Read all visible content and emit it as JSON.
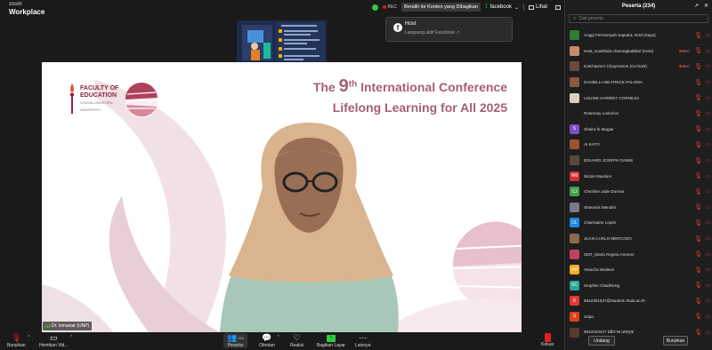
{
  "app": {
    "brand_top": "zoom",
    "brand_name": "Workplace"
  },
  "topbar": {
    "rec_label": "REC",
    "live_label": "Beralih ke Konten yang Dibagikan",
    "facebook_label": "facebook",
    "view_label": "Lihat"
  },
  "host_popup": {
    "title": "Host",
    "subtitle": "Langsung aktif Facebook"
  },
  "slide": {
    "line1_pre": "The ",
    "line1_num": "9",
    "line1_sup": "th",
    "line1_post": " International Conference",
    "line2": "Lifelong Learning for All 2025",
    "faculty_line1": "FACULTY OF",
    "faculty_line2": "EDUCATION",
    "faculty_line3": "CHULALONGKORN",
    "faculty_line4": "UNIVERSITY"
  },
  "speaker": {
    "name": "Dr. Ismaniar (UNP)"
  },
  "bottombar": {
    "unmute": "Bunyikan",
    "stop_video": "Hentikan Vid...",
    "participants": "Peserta",
    "participants_count": "234",
    "chat": "Obrolan",
    "reactions": "Reaksi",
    "share": "Bagikan Layar",
    "more": "Lainnya",
    "leave": "Keluar"
  },
  "participants_panel": {
    "title": "Peserta (234)",
    "search_placeholder": "Cari peserta",
    "invite": "Undang",
    "unmute_all": "Bunyikan",
    "list": [
      {
        "name": "Anggi Firmansyah Saputra, M.M (Saya)",
        "avatar": "",
        "color": "#2e7d32",
        "rec": false
      },
      {
        "name": "Host_suwithida charungkaittikul (Host)",
        "avatar": "",
        "color": "#c98a6a",
        "rec": true
      },
      {
        "name": "Kotchaworn Chuymanee (Co-host)",
        "avatar": "",
        "color": "#6b4a3a",
        "rec": true
      },
      {
        "name": "DANIELLA BEATRICE PALOMA",
        "avatar": "",
        "color": "#8a5a40",
        "rec": false
      },
      {
        "name": "LOUISE HARRIET CORNEJO",
        "avatar": "",
        "color": "#d9d0c0",
        "rec": false
      },
      {
        "name": "Rosemay Lodovice",
        "avatar": "",
        "color": "#1e1e1e",
        "rec": false
      },
      {
        "name": "Shaira fe Mugas",
        "avatar": "S",
        "color": "#7b4fc9",
        "rec": false
      },
      {
        "name": "AI KATO",
        "avatar": "",
        "color": "#a0522d",
        "rec": false
      },
      {
        "name": "EDUARD JOSEPH GAMIS",
        "avatar": "",
        "color": "#5a4a3a",
        "rec": false
      },
      {
        "name": "Nicole Maxilum",
        "avatar": "NM",
        "color": "#d32f2f",
        "rec": false
      },
      {
        "name": "Chezline Jade Durosa",
        "avatar": "CJ",
        "color": "#43a047",
        "rec": false
      },
      {
        "name": "Shavnick Mendez",
        "avatar": "",
        "color": "#7a7a8a",
        "rec": false
      },
      {
        "name": "Charmaine Lopez",
        "avatar": "CL",
        "color": "#1e88e5",
        "rec": false
      },
      {
        "name": "JUAN CARLO MERCADO",
        "avatar": "",
        "color": "#8a6a4a",
        "rec": false
      },
      {
        "name": "SMT_Maria Regina Amores",
        "avatar": "",
        "color": "#c04060",
        "rec": false
      },
      {
        "name": "Vinacha Wutisen",
        "avatar": "VW",
        "color": "#f9a825",
        "rec": false
      },
      {
        "name": "Smphim Chaithieng",
        "avatar": "SC",
        "color": "#26a69a",
        "rec": false
      },
      {
        "name": "6842301627@student.chula.ac.th",
        "avatar": "6",
        "color": "#e53935",
        "rec": false
      },
      {
        "name": "Sripa",
        "avatar": "S",
        "color": "#d84315",
        "rec": false
      },
      {
        "name": "6842523427 ผลิภาส เลขุนุช",
        "avatar": "",
        "color": "#5a3a2a",
        "rec": false
      }
    ]
  }
}
